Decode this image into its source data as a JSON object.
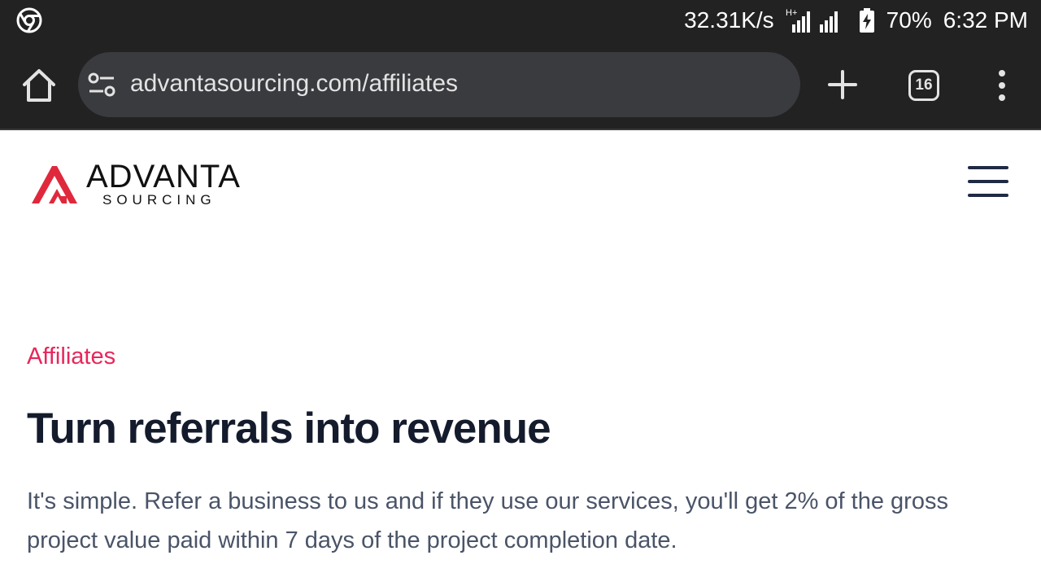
{
  "status_bar": {
    "network_speed": "32.31K/s",
    "network_type": "H+",
    "battery": "70%",
    "time": "6:32 PM"
  },
  "browser": {
    "url": "advantasourcing.com/affiliates",
    "tab_count": "16"
  },
  "site": {
    "logo_name": "ADVANTA",
    "logo_sub": "SOURCING"
  },
  "content": {
    "eyebrow": "Affiliates",
    "headline": "Turn referrals into revenue",
    "body": "It's simple. Refer a business to us and if they use our services, you'll get 2% of the gross project value paid within 7 days of the project completion date."
  },
  "colors": {
    "accent": "#e8265b",
    "logo_red": "#e0283c",
    "headline": "#141b2c",
    "body_text": "#4a5468",
    "browser_chrome": "#222222"
  }
}
